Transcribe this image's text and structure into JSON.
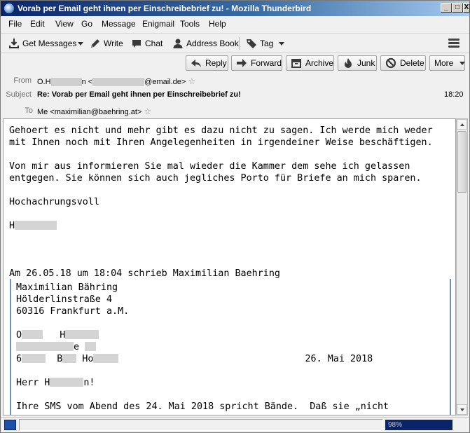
{
  "window": {
    "title": "Vorab per Email geht ihnen per Einschreibebrief zu! - Mozilla Thunderbird",
    "controls": {
      "minimize": "_",
      "maximize": "□",
      "close": "X"
    }
  },
  "menubar": {
    "items": [
      "File",
      "Edit",
      "View",
      "Go",
      "Message",
      "Enigmail",
      "Tools",
      "Help"
    ]
  },
  "toolbar": {
    "get_messages": "Get Messages",
    "write": "Write",
    "chat": "Chat",
    "address_book": "Address Book",
    "tag": "Tag"
  },
  "actions": {
    "reply": "Reply",
    "forward": "Forward",
    "archive": "Archive",
    "junk": "Junk",
    "delete": "Delete",
    "more": "More"
  },
  "header": {
    "from_label": "From",
    "from_name_start": "O.H",
    "from_name_end": "n <",
    "from_email_end": "@email.de>",
    "subject_label": "Subject",
    "subject": "Re: Vorab per Email geht ihnen per Einschreibebrief zu!",
    "time": "18:20",
    "to_label": "To",
    "to": "Me <maximilian@baehring.at>"
  },
  "body": {
    "line1": "Gehoert es nicht und mehr gibt es dazu nicht zu sagen. Ich werde mich weder",
    "line2": "mit Ihnen noch mit Ihren Angelegenheiten in irgendeiner Weise beschäftigen.",
    "line3": "Von mir aus informieren Sie mal wieder die Kammer dem sehe ich gelassen",
    "line4": "entgegen. Sie können sich auch jegliches Porto für Briefe an mich sparen.",
    "greeting": "Hochachrungsvoll",
    "signature_start": "H",
    "attribution": "Am 26.05.18 um 18:04 schrieb Maximilian Baehring"
  },
  "quote": {
    "name": "Maximilian Bähring",
    "street": "Hölderlinstraße 4",
    "city": "60316 Frankfurt a.M.",
    "rcpt_line1_a": "O",
    "rcpt_line1_b": "H",
    "rcpt_line2_end": "e",
    "rcpt_line3_a": "6",
    "rcpt_line3_b": "B",
    "rcpt_line3_c": "Ho",
    "date": "26. Mai 2018",
    "salutation_start": "Herr H",
    "salutation_end": "n!",
    "text1": "Ihre SMS vom Abend des 24. Mai 2018 spricht Bände.  Daß sie „nicht",
    "text2": "                                                                    "
  },
  "statusbar": {
    "progress": "98%"
  }
}
